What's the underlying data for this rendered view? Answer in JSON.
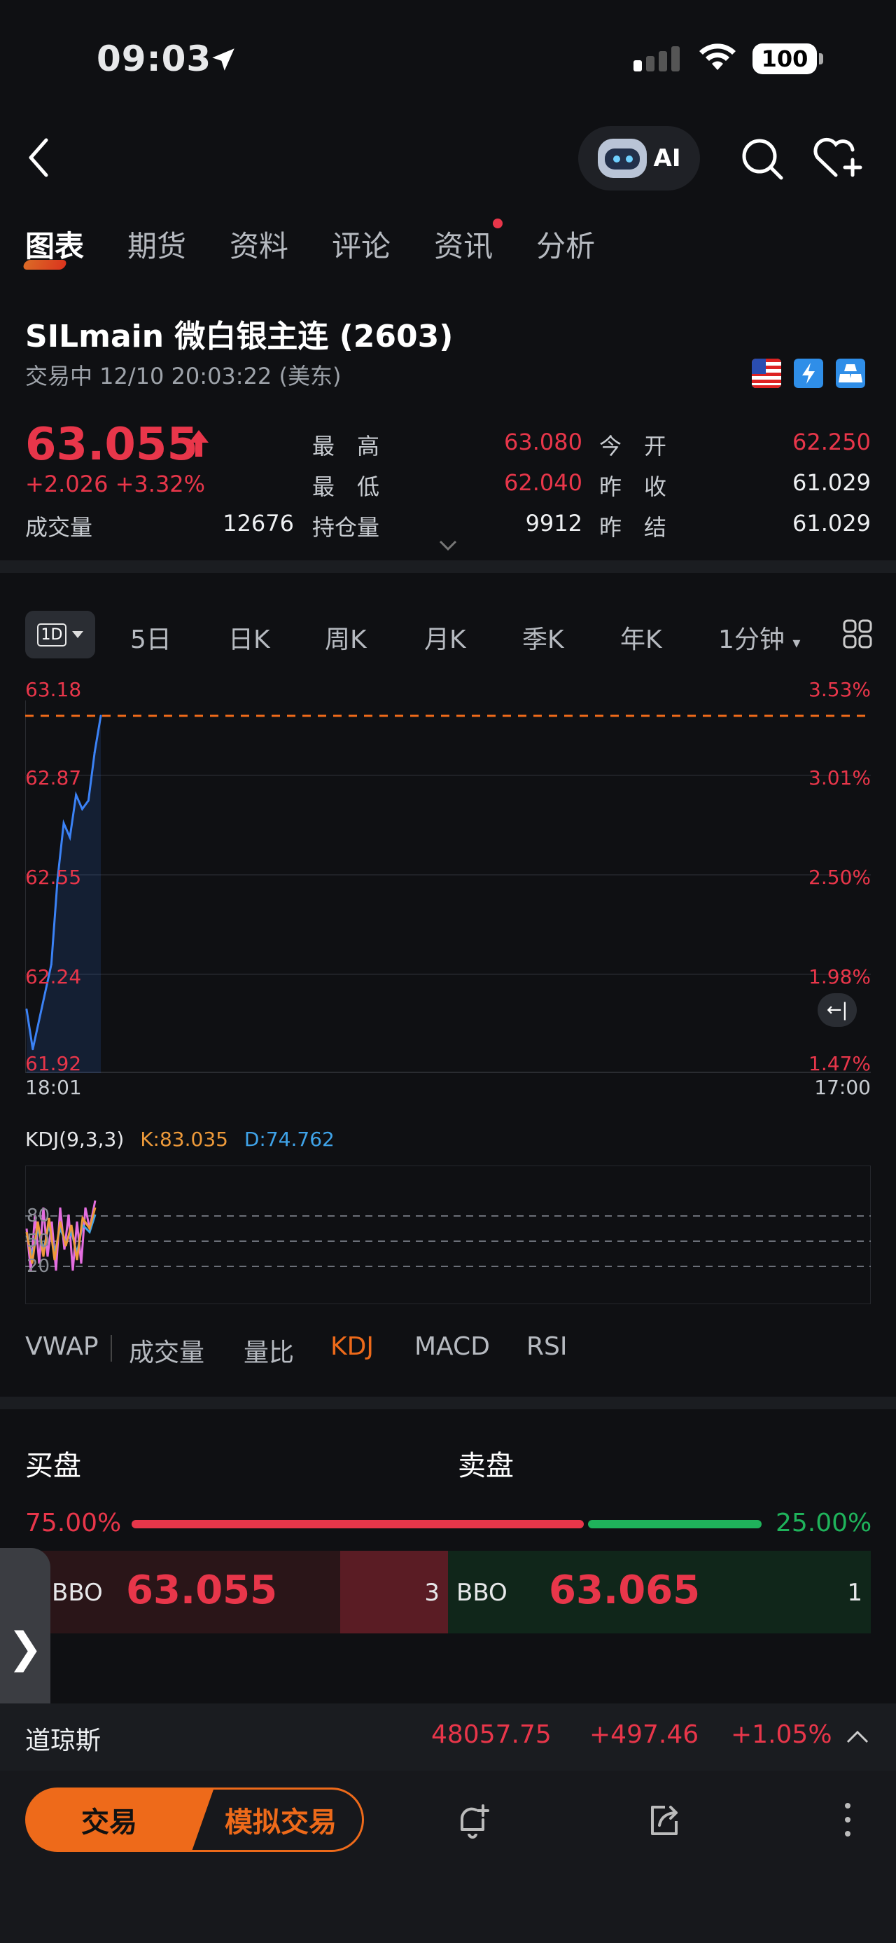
{
  "status_bar": {
    "time": "09:03",
    "battery": "100"
  },
  "nav": {
    "ai_label": "AI"
  },
  "tabs": [
    {
      "label": "图表",
      "active": true
    },
    {
      "label": "期货"
    },
    {
      "label": "资料"
    },
    {
      "label": "评论"
    },
    {
      "label": "资讯",
      "badge": true
    },
    {
      "label": "分析"
    }
  ],
  "symbol": {
    "title": "SILmain   微白银主连 (2603)",
    "subtitle": "交易中 12/10 20:03:22 (美东)"
  },
  "quote": {
    "price": "63.055",
    "change": "+2.026  +3.32%",
    "volume_label": "成交量",
    "volume": "12676",
    "high_label": "最　高",
    "high": "63.080",
    "low_label": "最　低",
    "low": "62.040",
    "oi_label": "持仓量",
    "oi": "9912",
    "open_label": "今　开",
    "open": "62.250",
    "prev_close_label": "昨　收",
    "prev_close": "61.029",
    "prev_settle_label": "昨　结",
    "prev_settle": "61.029"
  },
  "periods": [
    "1D",
    "5日",
    "日K",
    "周K",
    "月K",
    "季K",
    "年K",
    "1分钟"
  ],
  "chart": {
    "price_labels": [
      "63.18",
      "62.87",
      "62.55",
      "62.24",
      "61.92"
    ],
    "pct_labels": [
      "3.53%",
      "3.01%",
      "2.50%",
      "1.98%",
      "1.47%"
    ],
    "time_start": "18:01",
    "time_end": "17:00",
    "kdj_title": "KDJ(9,3,3)",
    "kdj_k": "K:83.035",
    "kdj_d": "D:74.762",
    "kdj_levels": [
      "80",
      "50",
      "20"
    ]
  },
  "chart_data": {
    "type": "line",
    "x": [
      "18:01",
      "18:05",
      "18:10",
      "18:15",
      "18:20",
      "18:25",
      "18:30",
      "18:35",
      "18:40",
      "18:45",
      "18:50",
      "18:55",
      "19:00"
    ],
    "series": [
      {
        "values": [
          62.14,
          62.0,
          62.1,
          62.2,
          62.3,
          62.6,
          62.8,
          62.75,
          62.9,
          62.85,
          62.88,
          63.05,
          63.18
        ]
      }
    ],
    "ylim": [
      61.92,
      63.18
    ],
    "xlabel": "",
    "ylabel": ""
  },
  "indicators": [
    "VWAP",
    "成交量",
    "量比",
    "KDJ",
    "MACD",
    "RSI"
  ],
  "active_indicator": "KDJ",
  "orderbook": {
    "buy_label": "买盘",
    "sell_label": "卖盘",
    "buy_pct": "75.00%",
    "sell_pct": "25.00%",
    "buy_fraction": 0.75,
    "bid_label": "BBO",
    "bid_price": "63.055",
    "bid_qty": "3",
    "ask_label": "BBO",
    "ask_price": "63.065",
    "ask_qty": "1"
  },
  "ticker": {
    "name": "道琼斯",
    "value": "48057.75",
    "change": "+497.46",
    "pct": "+1.05%"
  },
  "bottom": {
    "trade": "交易",
    "sim_trade": "模拟交易"
  },
  "colors": {
    "up": "#e8364a",
    "down": "#1fb35b",
    "accent": "#ee6a1a",
    "line": "#3b82f6"
  }
}
